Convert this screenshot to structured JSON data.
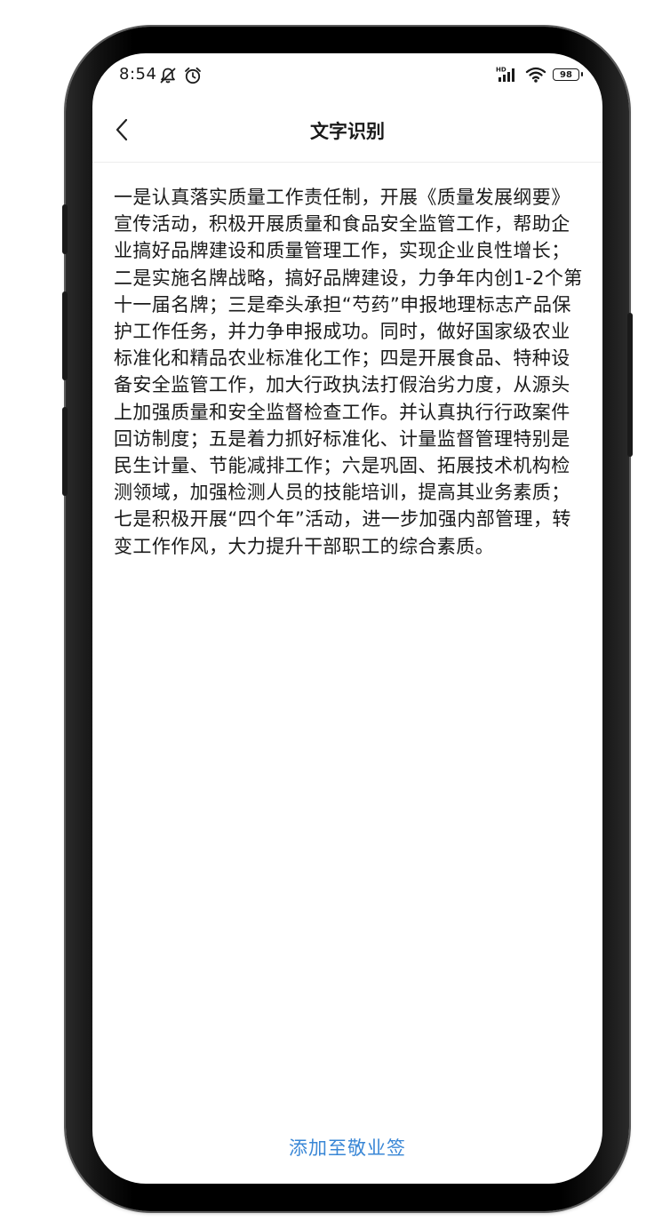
{
  "status_bar": {
    "time": "8:54",
    "battery_level": "98",
    "icons": [
      "notification-muted-icon",
      "alarm-icon",
      "hd-signal-icon",
      "wifi-icon",
      "battery-icon"
    ]
  },
  "nav": {
    "title": "文字识别",
    "back_icon": "chevron-left-icon"
  },
  "content": {
    "recognized_text": "一是认真落实质量工作责任制，开展《质量发展纲要》宣传活动，积极开展质量和食品安全监管工作，帮助企业搞好品牌建设和质量管理工作，实现企业良性增长；二是实施名牌战略，搞好品牌建设，力争年内创1-2个第十一届名牌；三是牵头承担“芍药”申报地理标志产品保护工作任务，并力争申报成功。同时，做好国家级农业标准化和精品农业标准化工作；四是开展食品、特种设备安全监管工作，加大行政执法打假治劣力度，从源头上加强质量和安全监督检查工作。并认真执行行政案件回访制度；五是着力抓好标准化、计量监督管理特别是民生计量、节能减排工作；六是巩固、拓展技术机构检测领域，加强检测人员的技能培训，提高其业务素质；七是积极开展“四个年”活动，进一步加强内部管理，转变工作作风，大力提升干部职工的综合素质。"
  },
  "actions": {
    "add_to_notes": "添加至敬业签"
  },
  "colors": {
    "accent": "#3a87d6",
    "text": "#1a1a1a",
    "frame": "#000000"
  }
}
